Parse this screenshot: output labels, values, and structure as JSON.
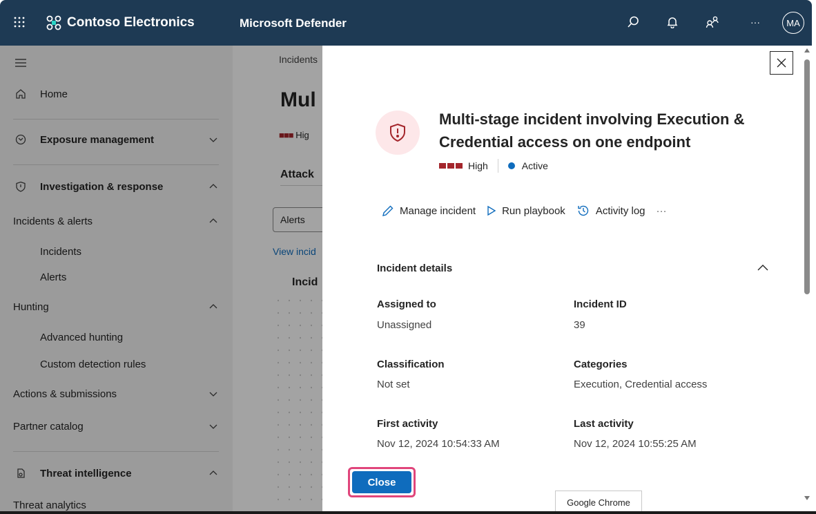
{
  "topbar": {
    "org_name": "Contoso Electronics",
    "product_name": "Microsoft Defender",
    "avatar_initials": "MA",
    "more_label": "···",
    "bg_color": "#1e3a54"
  },
  "sidebar": {
    "items": [
      {
        "label": "Home",
        "icon": "home-icon"
      },
      {
        "label": "Exposure management",
        "icon": "exposure-icon"
      },
      {
        "label": "Investigation & response",
        "icon": "shield-icon"
      },
      {
        "label": "Incidents & alerts"
      },
      {
        "label": "Incidents"
      },
      {
        "label": "Alerts"
      },
      {
        "label": "Hunting"
      },
      {
        "label": "Advanced hunting"
      },
      {
        "label": "Custom detection rules"
      },
      {
        "label": "Actions & submissions"
      },
      {
        "label": "Partner catalog"
      },
      {
        "label": "Threat intelligence",
        "icon": "threat-intel-icon"
      },
      {
        "label": "Threat analytics"
      }
    ]
  },
  "background_page": {
    "breadcrumb": "Incidents",
    "title": "Mul",
    "severity": "Hig",
    "tab": "Attack",
    "select_value": "Alerts",
    "link": "View incid",
    "column": "Incid"
  },
  "panel": {
    "title": "Multi-stage incident involving Execution & Credential access on one endpoint",
    "severity": "High",
    "status": "Active",
    "actions": {
      "manage": "Manage incident",
      "playbook": "Run playbook",
      "activity": "Activity log",
      "more": "···"
    },
    "section_title": "Incident details",
    "fields": {
      "assigned_label": "Assigned to",
      "assigned_value": "Unassigned",
      "id_label": "Incident ID",
      "id_value": "39",
      "classification_label": "Classification",
      "classification_value": "Not set",
      "categories_label": "Categories",
      "categories_value": "Execution, Credential access",
      "first_label": "First activity",
      "first_value": "Nov 12, 2024 10:54:33 AM",
      "last_label": "Last activity",
      "last_value": "Nov 12, 2024 10:55:25 AM"
    },
    "close_label": "Close",
    "severity_color": "#a4262c",
    "status_color": "#0f6cbd"
  },
  "tooltip": "Google Chrome"
}
